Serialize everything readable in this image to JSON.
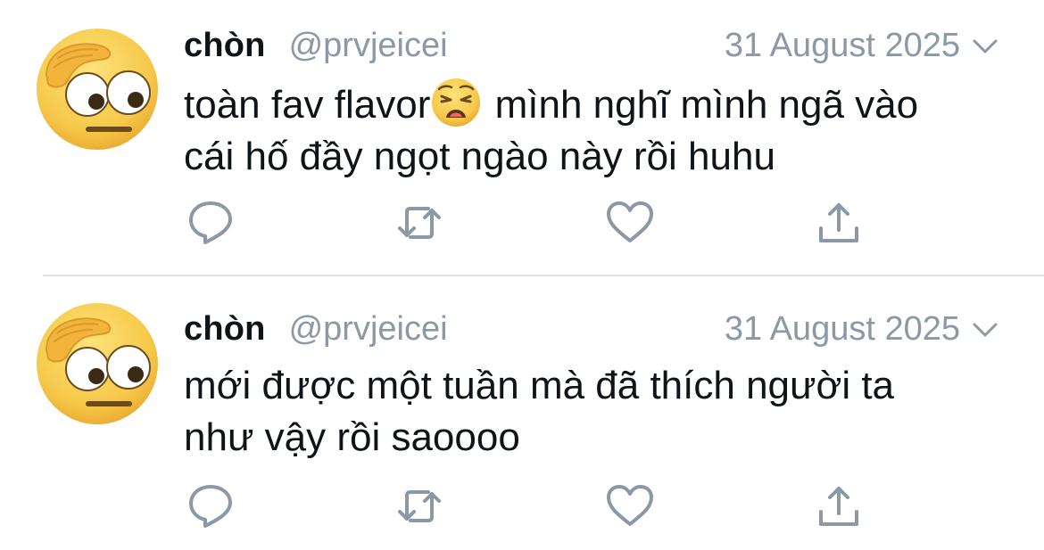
{
  "tweets": [
    {
      "display_name": "chòn",
      "handle": "@prvjeicei",
      "date": "31 August 2025",
      "text_line1_before": "toàn fav flavor",
      "text_line1_after": " mình nghĩ mình ngã vào",
      "text_line2": "cái hố đầy ngọt ngào này rồi huhu",
      "inline_emoji": "weary-face-emoji"
    },
    {
      "display_name": "chòn",
      "handle": "@prvjeicei",
      "date": "31 August 2025",
      "text_line1": "mới được một tuần mà đã thích người ta",
      "text_line2": "như vậy rồi saoooo"
    }
  ],
  "icons": {
    "avatar": "flushed-salute-emoji",
    "more": "chevron-down-icon",
    "reply": "reply-icon",
    "retweet": "retweet-icon",
    "like": "heart-icon",
    "share": "share-icon"
  },
  "colors": {
    "text": "#0f1419",
    "secondary": "#8b98a5",
    "icon": "#8b98a5",
    "divider": "#dfe3e6",
    "emoji_yellow": "#f6c84a"
  }
}
